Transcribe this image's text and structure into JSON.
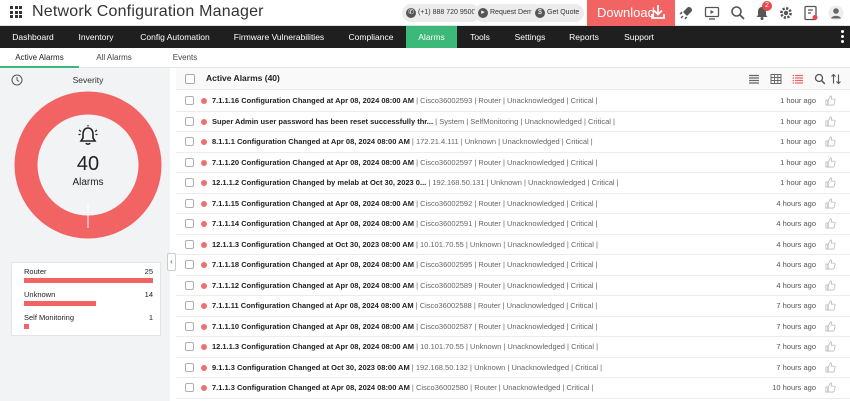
{
  "app": {
    "title": "Network Configuration Manager"
  },
  "topbar": {
    "phone": "(+1) 888 720 9500",
    "request_demo": "Request Demo",
    "get_quote": "Get Quote",
    "download": "Download",
    "notification_count": "2"
  },
  "nav": {
    "items": [
      {
        "label": "Dashboard"
      },
      {
        "label": "Inventory"
      },
      {
        "label": "Config Automation"
      },
      {
        "label": "Firmware Vulnerabilities"
      },
      {
        "label": "Compliance"
      },
      {
        "label": "Alarms"
      },
      {
        "label": "Tools"
      },
      {
        "label": "Settings"
      },
      {
        "label": "Reports"
      },
      {
        "label": "Support"
      }
    ],
    "active": "Alarms"
  },
  "subtabs": [
    {
      "label": "Active Alarms"
    },
    {
      "label": "All Alarms"
    },
    {
      "label": "Events"
    }
  ],
  "severity": {
    "title": "Severity",
    "total": "40",
    "total_label": "Alarms",
    "items": [
      {
        "name": "Router",
        "count": "25",
        "fraction": 1.0
      },
      {
        "name": "Unknown",
        "count": "14",
        "fraction": 0.56
      },
      {
        "name": "Self Monitoring",
        "count": "1",
        "fraction": 0.04
      }
    ]
  },
  "alarms": {
    "title": "Active Alarms (40)",
    "rows": [
      {
        "message": "7.1.1.16 Configuration Changed at Apr 08, 2024 08:00 AM",
        "details": "Cisco36002593 | Router | Unacknowledged | Critical |",
        "time": "1 hour ago"
      },
      {
        "message": "Super Admin user password has been reset successfully thr...",
        "details": "System | SelfMonitoring | Unacknowledged | Critical |",
        "time": "1 hour ago"
      },
      {
        "message": "8.1.1.1 Configuration Changed at Apr 08, 2024 08:00 AM",
        "details": "172.21.4.111 | Unknown | Unacknowledged | Critical |",
        "time": "1 hour ago"
      },
      {
        "message": "7.1.1.20 Configuration Changed at Apr 08, 2024 08:00 AM",
        "details": "Cisco36002597 | Router | Unacknowledged | Critical |",
        "time": "1 hour ago"
      },
      {
        "message": "12.1.1.2 Configuration Changed by melab at Oct 30, 2023 0...",
        "details": "192.168.50.131 | Unknown | Unacknowledged | Critical |",
        "time": "1 hour ago"
      },
      {
        "message": "7.1.1.15 Configuration Changed at Apr 08, 2024 08:00 AM",
        "details": "Cisco36002592 | Router | Unacknowledged | Critical |",
        "time": "4 hours ago"
      },
      {
        "message": "7.1.1.14 Configuration Changed at Apr 08, 2024 08:00 AM",
        "details": "Cisco36002591 | Router | Unacknowledged | Critical |",
        "time": "4 hours ago"
      },
      {
        "message": "12.1.1.3 Configuration Changed at Oct 30, 2023 08:00 AM",
        "details": "10.101.70.55 | Unknown | Unacknowledged | Critical |",
        "time": "4 hours ago"
      },
      {
        "message": "7.1.1.18 Configuration Changed at Apr 08, 2024 08:00 AM",
        "details": "Cisco36002595 | Router | Unacknowledged | Critical |",
        "time": "4 hours ago"
      },
      {
        "message": "7.1.1.12 Configuration Changed at Apr 08, 2024 08:00 AM",
        "details": "Cisco36002589 | Router | Unacknowledged | Critical |",
        "time": "4 hours ago"
      },
      {
        "message": "7.1.1.11 Configuration Changed at Apr 08, 2024 08:00 AM",
        "details": "Cisco36002588 | Router | Unacknowledged | Critical |",
        "time": "7 hours ago"
      },
      {
        "message": "7.1.1.10 Configuration Changed at Apr 08, 2024 08:00 AM",
        "details": "Cisco36002587 | Router | Unacknowledged | Critical |",
        "time": "7 hours ago"
      },
      {
        "message": "12.1.1.3 Configuration Changed at Apr 08, 2024 08:00 AM",
        "details": "10.101.70.55 | Unknown | Unacknowledged | Critical |",
        "time": "7 hours ago"
      },
      {
        "message": "9.1.1.3 Configuration Changed at Oct 30, 2023 08:00 AM",
        "details": "192.168.50.132 | Unknown | Unacknowledged | Critical |",
        "time": "7 hours ago"
      },
      {
        "message": "7.1.1.3 Configuration Changed at Apr 08, 2024 08:00 AM",
        "details": "Cisco36002580 | Router | Unacknowledged | Critical |",
        "time": "10 hours ago"
      }
    ]
  },
  "colors": {
    "accent": "#3cb878",
    "critical": "#f26363",
    "navbar": "#1f1f1f"
  }
}
